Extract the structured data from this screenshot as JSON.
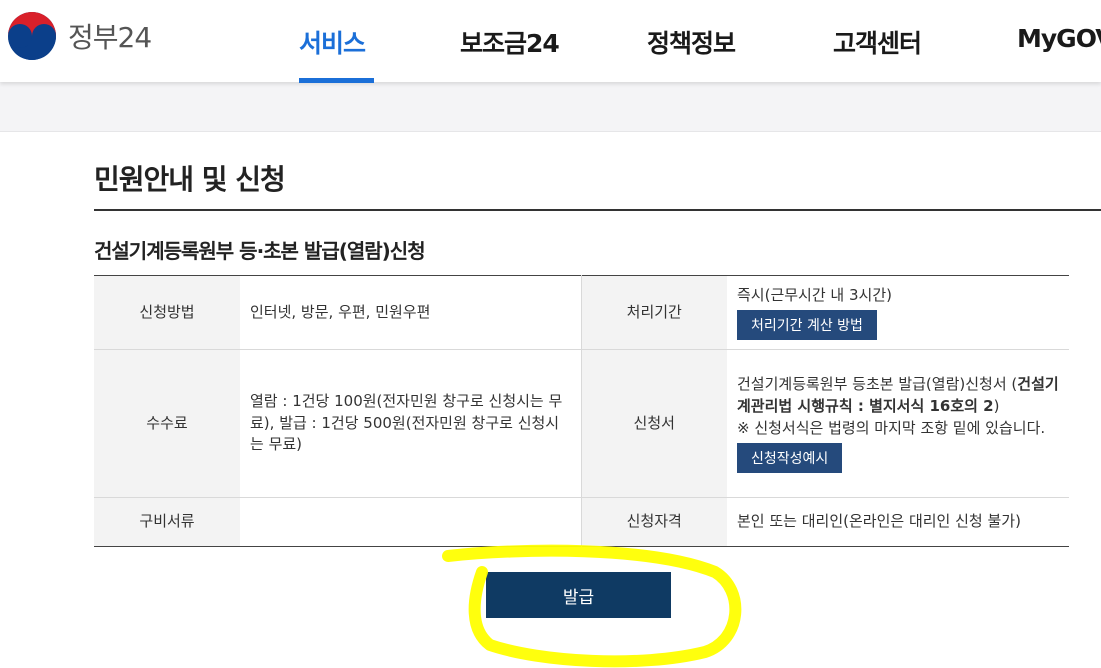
{
  "header": {
    "logo_text": "정부24",
    "nav": [
      {
        "label": "서비스",
        "active": true
      },
      {
        "label": "보조금24",
        "active": false
      },
      {
        "label": "정책정보",
        "active": false
      },
      {
        "label": "고객센터",
        "active": false
      },
      {
        "label": "MyGOV",
        "active": false
      }
    ]
  },
  "page": {
    "title": "민원안내 및 신청",
    "section_title": "건설기계등록원부 등·초본 발급(열람)신청"
  },
  "table": {
    "method_label": "신청방법",
    "method_value": "인터넷, 방문, 우편, 민원우편",
    "period_label": "처리기간",
    "period_value": "즉시(근무시간 내 3시간)",
    "period_button": "처리기간 계산 방법",
    "fee_label": "수수료",
    "fee_value": "열람 : 1건당 100원(전자민원 창구로 신청시는 무료), 발급 : 1건당 500원(전자민원 창구로 신청시는 무료)",
    "form_label": "신청서",
    "form_value_plain": "건설기계등록원부 등초본 발급(열람)신청서 (",
    "form_value_bold": "건설기계관리법 시행규칙 : 별지서식 16호의 2",
    "form_value_close": ")",
    "form_note": "※ 신청서식은 법령의 마지막 조항 밑에 있습니다.",
    "form_button": "신청작성예시",
    "docs_label": "구비서류",
    "docs_value": "",
    "qual_label": "신청자격",
    "qual_value": "본인 또는 대리인(온라인은 대리인 신청 불가)"
  },
  "actions": {
    "issue_button": "발급"
  },
  "colors": {
    "accent": "#1b6fd8",
    "button_dark": "#0f3a63",
    "button_small": "#254a7c",
    "highlight": "#ffff00"
  }
}
